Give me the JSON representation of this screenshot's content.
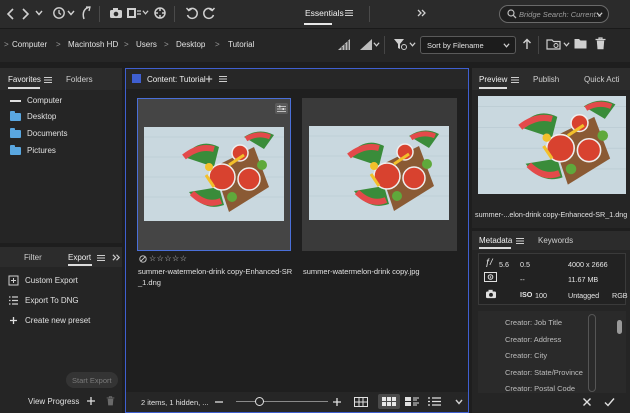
{
  "toolbar": {
    "workspace_label": "Essentials",
    "search_placeholder": "Bridge Search: Current..."
  },
  "breadcrumb": {
    "items": [
      "Computer",
      "Macintosh HD",
      "Users",
      "Desktop",
      "Tutorial"
    ],
    "separator": ">"
  },
  "sort": {
    "label": "Sort by Filename"
  },
  "left_panel": {
    "tabs": [
      "Favorites",
      "Folders"
    ],
    "favorites": [
      {
        "label": "Computer",
        "icon": "computer-icon"
      },
      {
        "label": "Desktop",
        "icon": "folder-icon"
      },
      {
        "label": "Documents",
        "icon": "folder-icon"
      },
      {
        "label": "Pictures",
        "icon": "folder-icon"
      }
    ]
  },
  "export_panel": {
    "tabs": [
      "Filter",
      "Export"
    ],
    "items": [
      {
        "label": "Custom Export",
        "icon": "custom-export-icon"
      },
      {
        "label": "Export To DNG",
        "icon": "export-dng-icon"
      },
      {
        "label": "Create new preset",
        "icon": "plus-icon"
      }
    ],
    "start_export_label": "Start Export",
    "view_progress_label": "View Progress"
  },
  "content": {
    "title": "Content: Tutorial",
    "items": [
      {
        "filename": "summer-watermelon-drink copy-Enhanced-SR_1.dng",
        "line1": "summer-watermelon-drink copy-Enhanced-SR",
        "line2": "_1.dng",
        "selected": true,
        "rating_stars": "☆☆☆☆☆"
      },
      {
        "filename": "summer-watermelon-drink copy.jpg",
        "line1": "summer-watermelon-drink copy.jpg",
        "line2": "",
        "selected": false
      }
    ],
    "status_text": "2 items, 1 hidden, ...",
    "zoom_level": 0.25
  },
  "preview_panel": {
    "tabs": [
      "Preview",
      "Publish",
      "Quick Acti"
    ],
    "caption": "summer-...elon-drink copy-Enhanced-SR_1.dng"
  },
  "metadata_panel": {
    "tabs": [
      "Metadata",
      "Keywords"
    ],
    "aperture": "5.6",
    "shutter": "0.5",
    "dimensions": "4000 x 2666",
    "size": "11.67 MB",
    "dash": "--",
    "iso_label": "ISO",
    "iso_value": "100",
    "tagged": "Untagged",
    "color_mode": "RGB",
    "fields": [
      "Creator: Job Title",
      "Creator: Address",
      "Creator: City",
      "Creator: State/Province",
      "Creator: Postal Code"
    ]
  },
  "colors": {
    "accent": "#3f5fd0",
    "selection_border": "#4a6fd8",
    "folder": "#5aa7e0"
  }
}
